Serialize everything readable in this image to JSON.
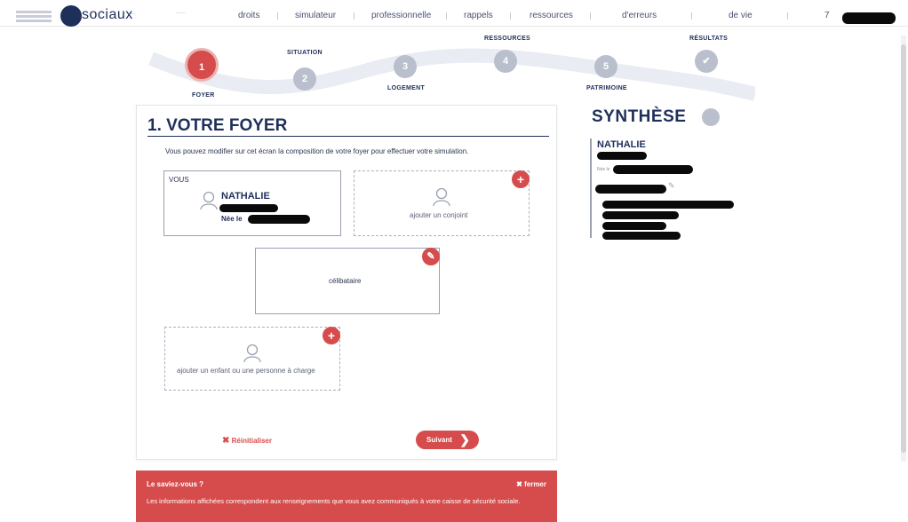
{
  "header": {
    "brand": "sociaux",
    "nav": [
      "droits",
      "simulateur",
      "professionnelle",
      "rappels",
      "ressources",
      "d'erreurs",
      "de vie",
      "7"
    ]
  },
  "stepper": {
    "steps": [
      {
        "num": "1",
        "label": "FOYER"
      },
      {
        "num": "2",
        "label": "SITUATION"
      },
      {
        "num": "3",
        "label": "LOGEMENT"
      },
      {
        "num": "4",
        "label": "RESSOURCES"
      },
      {
        "num": "5",
        "label": "PATRIMOINE"
      },
      {
        "num": "✔",
        "label": "RÉSULTATS"
      }
    ]
  },
  "foyer": {
    "title": "1. VOTRE FOYER",
    "intro": "Vous pouvez modifier sur cet écran la composition de votre foyer pour effectuer votre simulation.",
    "you_card": {
      "tag": "VOUS",
      "name": "NATHALIE",
      "born_label": "Née le"
    },
    "spouse_card": {
      "label": "ajouter un conjoint"
    },
    "status_card": {
      "label": "célibataire"
    },
    "child_card": {
      "label": "ajouter un enfant ou une personne à charge"
    },
    "reset_label": "Réinitialiser",
    "next_label": "Suivant"
  },
  "tip": {
    "title": "Le saviez-vous ?",
    "close_label": "fermer",
    "body": "Les informations affichées correspondent aux renseignements que vous avez communiqués à votre caisse de sécurité sociale."
  },
  "synthese": {
    "title": "SYNTHÈSE",
    "name": "NATHALIE",
    "born_label": "Née le"
  },
  "colors": {
    "accent": "#d64c4c",
    "navy": "#1e2f5a",
    "muted": "#b9bfcc"
  }
}
